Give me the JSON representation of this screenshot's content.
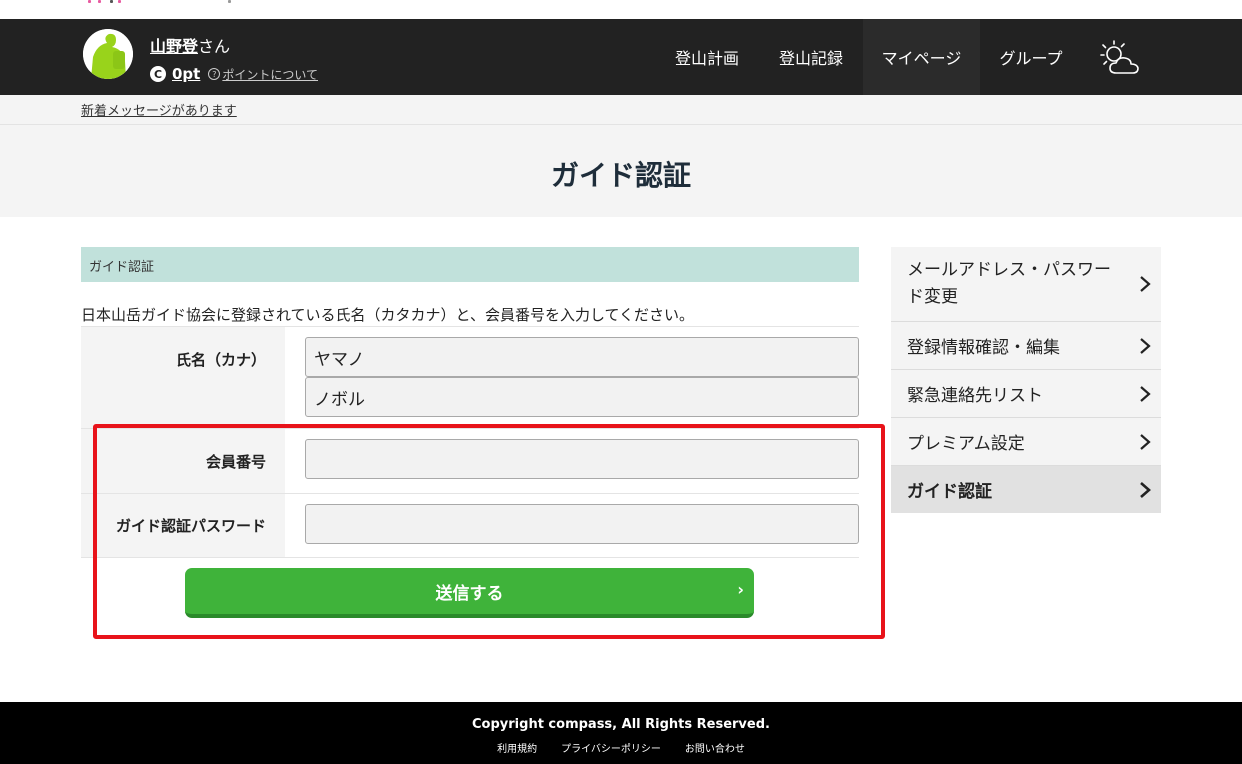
{
  "header": {
    "user_name": "山野登",
    "user_suffix": "さん",
    "points": "0pt",
    "points_link": "ポイントについて",
    "coin_glyph": "C",
    "help_glyph": "?",
    "nav": [
      "登山計画",
      "登山記録",
      "マイページ",
      "グループ"
    ],
    "avatar_color": "#99d31b",
    "weather_icon": "weather-sun-cloud-icon"
  },
  "message_bar": {
    "text": "新着メッセージがあります"
  },
  "page": {
    "title": "ガイド認証"
  },
  "form": {
    "section_title": "ガイド認証",
    "description": "日本山岳ガイド協会に登録されている氏名（カタカナ）と、会員番号を入力してください。",
    "name_label": "氏名（カナ）",
    "last_name_value": "ヤマノ",
    "first_name_value": "ノボル",
    "member_label": "会員番号",
    "member_value": "",
    "password_label": "ガイド認証パスワード",
    "password_value": "",
    "submit_label": "送信する",
    "submit_chevron": "›",
    "submit_color": "#3fb33a",
    "highlight_color": "#e8131a"
  },
  "sidebar": {
    "items": [
      {
        "label": "メールアドレス・パスワード変更",
        "active": false
      },
      {
        "label": "登録情報確認・編集",
        "active": false
      },
      {
        "label": "緊急連絡先リスト",
        "active": false
      },
      {
        "label": "プレミアム設定",
        "active": false
      },
      {
        "label": "ガイド認証",
        "active": true
      }
    ]
  },
  "footer": {
    "copyright": "Copyright compass, All Rights Reserved.",
    "links": [
      "利用規約",
      "プライバシーポリシー",
      "お問い合わせ"
    ]
  }
}
